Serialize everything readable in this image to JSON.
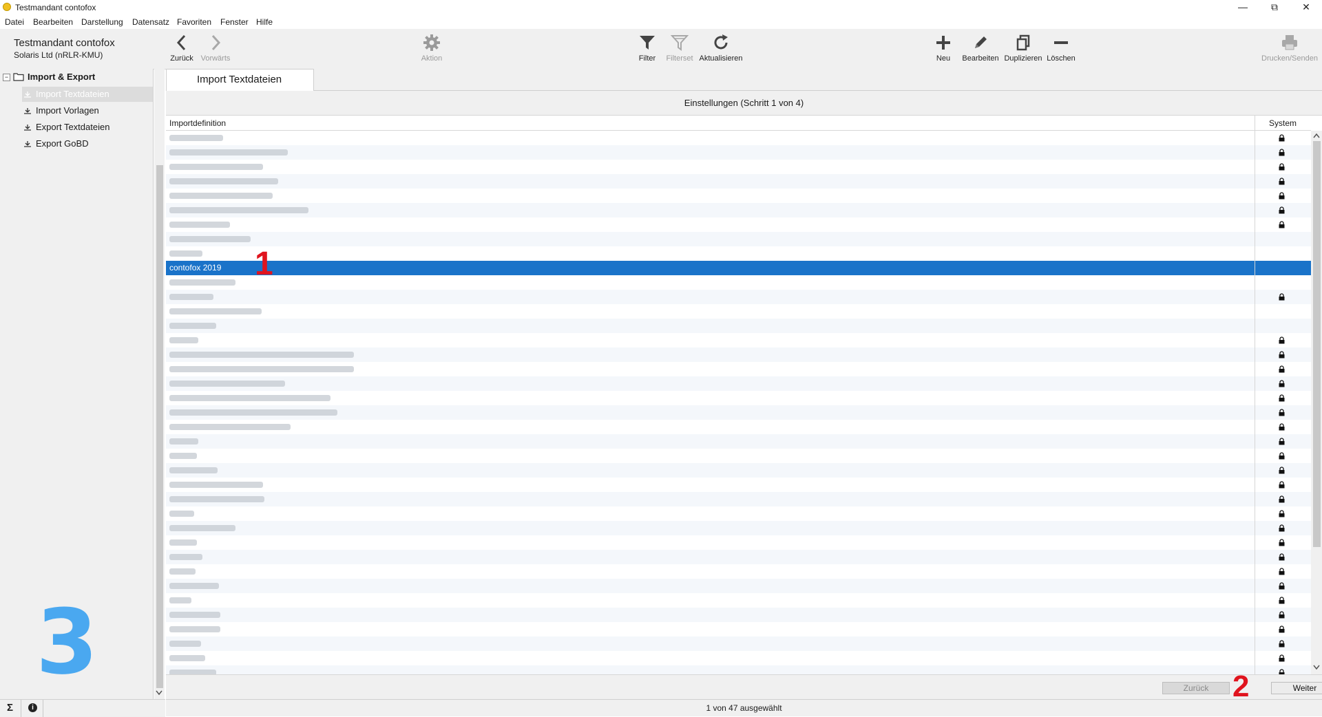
{
  "window": {
    "title": "Testmandant contofox"
  },
  "menu": [
    "Datei",
    "Bearbeiten",
    "Darstellung",
    "Datensatz",
    "Favoriten",
    "Fenster",
    "Hilfe"
  ],
  "tenant": {
    "name": "Testmandant contofox",
    "sub": "Solaris Ltd  (nRLR-KMU)"
  },
  "toolbar": {
    "back": "Zurück",
    "forward": "Vorwärts",
    "action": "Aktion",
    "filter": "Filter",
    "filterset": "Filterset",
    "refresh": "Aktualisieren",
    "new": "Neu",
    "edit": "Bearbeiten",
    "duplicate": "Duplizieren",
    "delete": "Löschen",
    "print": "Drucken/Senden"
  },
  "sidebar": {
    "group": "Import & Export",
    "items": [
      {
        "label": "Import Textdateien",
        "selected": true
      },
      {
        "label": "Import Vorlagen",
        "selected": false
      },
      {
        "label": "Export Textdateien",
        "selected": false
      },
      {
        "label": "Export GoBD",
        "selected": false
      }
    ]
  },
  "tab": {
    "label": "Import Textdateien"
  },
  "step": {
    "label": "Einstellungen (Schritt 1 von 4)"
  },
  "grid": {
    "col_def": "Importdefinition",
    "col_system": "System",
    "selected_label": "contofox 2019",
    "rows": [
      {
        "locked": true
      },
      {
        "locked": true
      },
      {
        "locked": true
      },
      {
        "locked": true
      },
      {
        "locked": true
      },
      {
        "locked": true
      },
      {
        "locked": true
      },
      {
        "locked": false
      },
      {
        "locked": false
      },
      {
        "locked": false,
        "selected": true
      },
      {
        "locked": false
      },
      {
        "locked": true
      },
      {
        "locked": false
      },
      {
        "locked": false
      },
      {
        "locked": true
      },
      {
        "locked": true
      },
      {
        "locked": true
      },
      {
        "locked": true
      },
      {
        "locked": true
      },
      {
        "locked": true
      },
      {
        "locked": true
      },
      {
        "locked": true
      },
      {
        "locked": true
      },
      {
        "locked": true
      },
      {
        "locked": true
      },
      {
        "locked": true
      },
      {
        "locked": true
      },
      {
        "locked": true
      },
      {
        "locked": true
      },
      {
        "locked": true
      },
      {
        "locked": true
      },
      {
        "locked": true
      },
      {
        "locked": true
      },
      {
        "locked": true
      },
      {
        "locked": true
      },
      {
        "locked": true
      },
      {
        "locked": true
      },
      {
        "locked": true
      }
    ]
  },
  "buttons": {
    "back": "Zurück",
    "next": "Weiter"
  },
  "status": {
    "text": "1 von 47 ausgewählt"
  },
  "annotations": {
    "one": "1",
    "two": "2",
    "three": "3"
  },
  "status_left": {
    "sum_symbol": "Σ",
    "info_symbol": "i"
  },
  "colors": {
    "selection": "#1a73c9",
    "annotation_red": "#e0141e",
    "annotation_blue": "#4aa8f0"
  }
}
